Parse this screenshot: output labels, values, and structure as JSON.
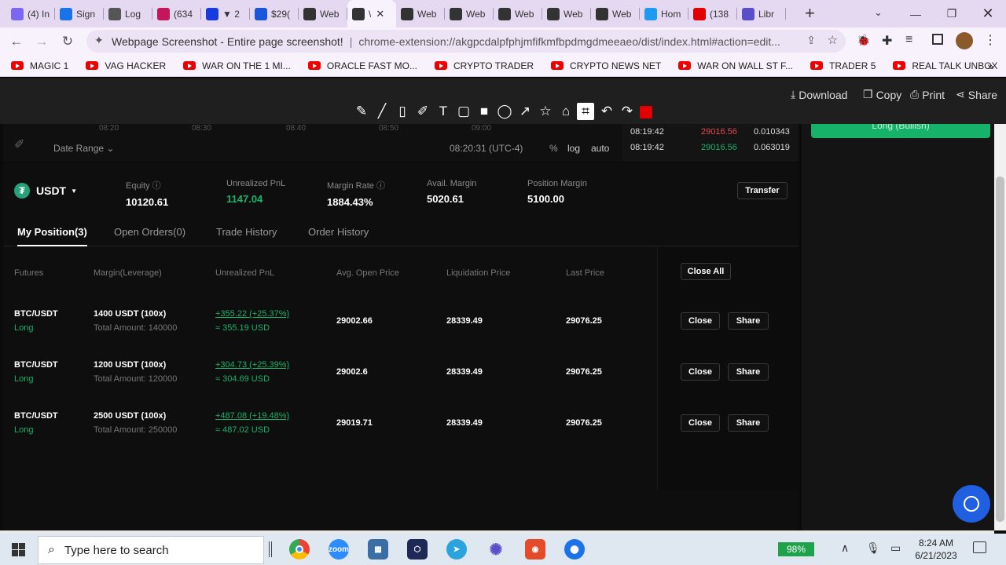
{
  "browser": {
    "tabs": [
      {
        "label": "(4) In",
        "icon": "gmail-icon",
        "color": "#7b68ee"
      },
      {
        "label": "Sign",
        "icon": "settings-gear-icon",
        "color": "#1a73e8"
      },
      {
        "label": "Log",
        "icon": "globe-icon",
        "color": "#555555"
      },
      {
        "label": "(634",
        "icon": "notification-badge-icon",
        "color": "#c2185b"
      },
      {
        "label": "▼ 2",
        "icon": "slash-logo-icon",
        "color": "#1a3bdb"
      },
      {
        "label": "$29(",
        "icon": "x-logo-icon",
        "color": "#1a56db"
      },
      {
        "label": "Web",
        "icon": "screenshot-extension-icon",
        "color": "#333333"
      },
      {
        "label": "\\",
        "icon": "screenshot-extension-icon",
        "color": "#333333",
        "active": true
      },
      {
        "label": "Web",
        "icon": "screenshot-extension-icon",
        "color": "#333333"
      },
      {
        "label": "Web",
        "icon": "screenshot-extension-icon",
        "color": "#333333"
      },
      {
        "label": "Web",
        "icon": "screenshot-extension-icon",
        "color": "#333333"
      },
      {
        "label": "Web",
        "icon": "screenshot-extension-icon",
        "color": "#333333"
      },
      {
        "label": "Web",
        "icon": "screenshot-extension-icon",
        "color": "#333333"
      },
      {
        "label": "Hom",
        "icon": "twitter-icon",
        "color": "#1d9bf0"
      },
      {
        "label": "(138",
        "icon": "youtube-icon",
        "color": "#e00000"
      },
      {
        "label": "Libr",
        "icon": "gear-icon",
        "color": "#5b4fc9"
      }
    ],
    "new_tab": "+",
    "address_title": "Webpage Screenshot - Entire page screenshot!",
    "address_url": "chrome-extension://akgpcdalpfphjmfifkmfbpdmgdmeeaeo/dist/index.html#action=edit...",
    "bookmarks": [
      "MAGIC 1",
      "VAG HACKER",
      "WAR ON THE 1 MI...",
      "ORACLE FAST MO...",
      "CRYPTO TRADER",
      "CRYPTO NEWS NET",
      "WAR ON WALL ST F...",
      "TRADER 5",
      "REAL TALK UNBOX"
    ],
    "bookmarks_more": "»"
  },
  "extension_toolbar": {
    "download": "Download",
    "copy": "Copy",
    "print": "Print",
    "share": "Share",
    "accent": "#e00000"
  },
  "chart_strip": {
    "times": [
      "08:20",
      "08:30",
      "08:40",
      "08:50",
      "09:00"
    ],
    "date_range": "Date Range",
    "clock": "08:20:31 (UTC-4)",
    "percent": "%",
    "log": "log",
    "auto": "auto"
  },
  "recent_trades": [
    {
      "time": "08:19:42",
      "price": "29016.56",
      "amount": "0.010343",
      "side": "sell"
    },
    {
      "time": "08:19:42",
      "price": "29016.56",
      "amount": "0.063019",
      "side": "buy"
    }
  ],
  "right_panel": {
    "long_button": "Long (Bullish)"
  },
  "account": {
    "currency": "USDT",
    "equity_label": "Equity",
    "equity": "10120.61",
    "unrealized_label": "Unrealized PnL",
    "unrealized": "1147.04",
    "margin_rate_label": "Margin Rate",
    "margin_rate": "1884.43%",
    "avail_margin_label": "Avail. Margin",
    "avail_margin": "5020.61",
    "position_margin_label": "Position Margin",
    "position_margin": "5100.00",
    "transfer": "Transfer"
  },
  "tabs": [
    "My Position(3)",
    "Open Orders(0)",
    "Trade History",
    "Order History"
  ],
  "table": {
    "headers": [
      "Futures",
      "Margin(Leverage)",
      "Unrealized PnL",
      "Avg. Open Price",
      "Liquidation Price",
      "Last Price"
    ],
    "close_all": "Close All",
    "rows": [
      {
        "pair": "BTC/USDT",
        "side": "Long",
        "margin": "1400 USDT (100x)",
        "total": "Total Amount: 140000",
        "pnl": "+355.22 (+25.37%)",
        "pnl_usd": "≈ 355.19 USD",
        "avg_open": "29002.66",
        "liq": "28339.49",
        "last": "29076.25",
        "close": "Close",
        "share": "Share"
      },
      {
        "pair": "BTC/USDT",
        "side": "Long",
        "margin": "1200 USDT (100x)",
        "total": "Total Amount: 120000",
        "pnl": "+304.73 (+25.39%)",
        "pnl_usd": "≈ 304.69 USD",
        "avg_open": "29002.6",
        "liq": "28339.49",
        "last": "29076.25",
        "close": "Close",
        "share": "Share"
      },
      {
        "pair": "BTC/USDT",
        "side": "Long",
        "margin": "2500 USDT (100x)",
        "total": "Total Amount: 250000",
        "pnl": "+487.08 (+19.48%)",
        "pnl_usd": "≈ 487.02 USD",
        "avg_open": "29019.71",
        "liq": "28339.49",
        "last": "29076.25",
        "close": "Close",
        "share": "Share"
      }
    ]
  },
  "taskbar": {
    "search_placeholder": "Type here to search",
    "battery": "98%",
    "time": "8:24 AM",
    "date": "6/21/2023"
  }
}
